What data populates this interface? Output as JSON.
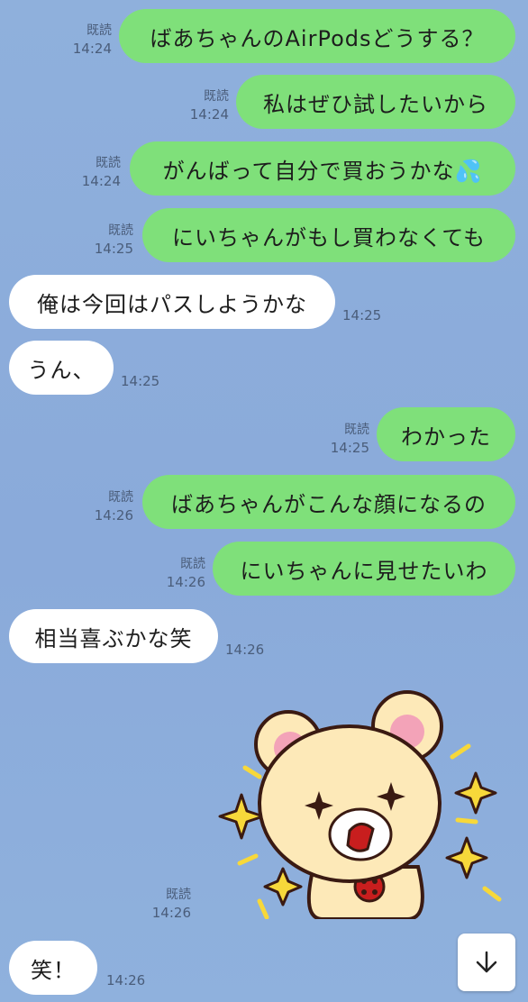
{
  "messages": [
    {
      "side": "right",
      "text": "ばあちゃんのAirPodsどうする？",
      "read": "既読",
      "time": "14:24"
    },
    {
      "side": "right",
      "text": "私はぜひ試したいから",
      "read": "既読",
      "time": "14:24"
    },
    {
      "side": "right",
      "text": "がんばって自分で買おうかな💦",
      "read": "既読",
      "time": "14:24"
    },
    {
      "side": "right",
      "text": "にいちゃんがもし買わなくても",
      "read": "既読",
      "time": "14:25"
    },
    {
      "side": "left",
      "text": "俺は今回はパスしようかな",
      "time": "14:25"
    },
    {
      "side": "left",
      "text": "うん、",
      "time": "14:25"
    },
    {
      "side": "right",
      "text": "わかった",
      "read": "既読",
      "time": "14:25"
    },
    {
      "side": "right",
      "text": "ばあちゃんがこんな顔になるの",
      "read": "既読",
      "time": "14:26"
    },
    {
      "side": "right",
      "text": "にいちゃんに見せたいわ",
      "read": "既読",
      "time": "14:26"
    },
    {
      "side": "left",
      "text": "相当喜ぶかな笑",
      "time": "14:26"
    },
    {
      "side": "sticker",
      "read": "既読",
      "time": "14:26",
      "sticker": "rilakkuma-sparkle-sticker"
    },
    {
      "side": "left",
      "text": "笑！",
      "time": "14:26"
    }
  ],
  "scroll_button": {
    "icon": "arrow-down-icon"
  },
  "colors": {
    "background": "#8fb0dc",
    "sent_bubble": "#7fe07a",
    "received_bubble": "#ffffff",
    "meta_text": "#4a5d7a"
  }
}
